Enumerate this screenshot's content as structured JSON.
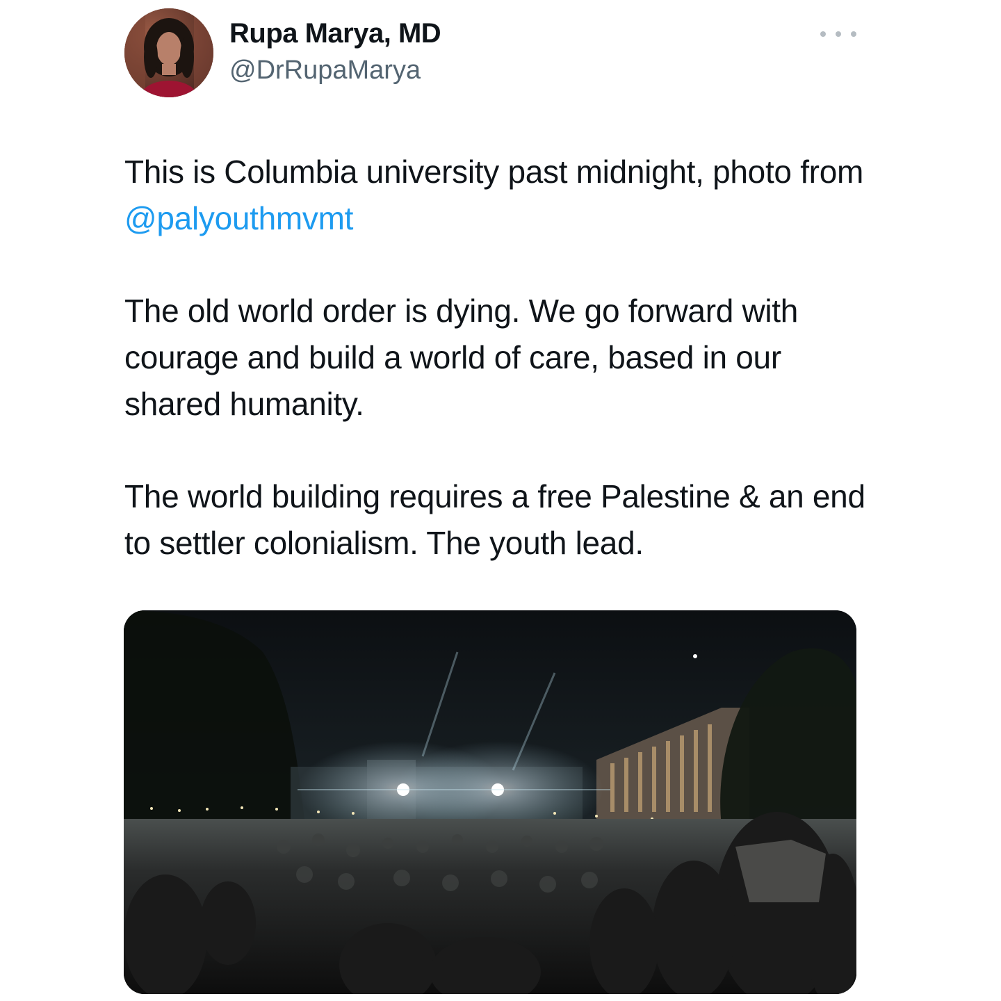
{
  "author": {
    "display_name": "Rupa Marya, MD",
    "handle": "@DrRupaMarya",
    "avatar_icon": "profile-photo"
  },
  "menu": {
    "icon": "more-options-icon"
  },
  "tweet": {
    "paragraph_1_text": "This is Columbia university past midnight, photo from ",
    "paragraph_1_mention": "@palyouthmvmt",
    "paragraph_2": "The old world order is dying. We go forward with courage and build a world of care, based in our shared humanity.",
    "paragraph_3": "The world building requires a free Palestine & an end to settler colonialism. The youth lead."
  },
  "media": {
    "icon": "night-crowd-photo"
  },
  "colors": {
    "text": "#0f1419",
    "secondary": "#536471",
    "link": "#1d9bf0"
  }
}
